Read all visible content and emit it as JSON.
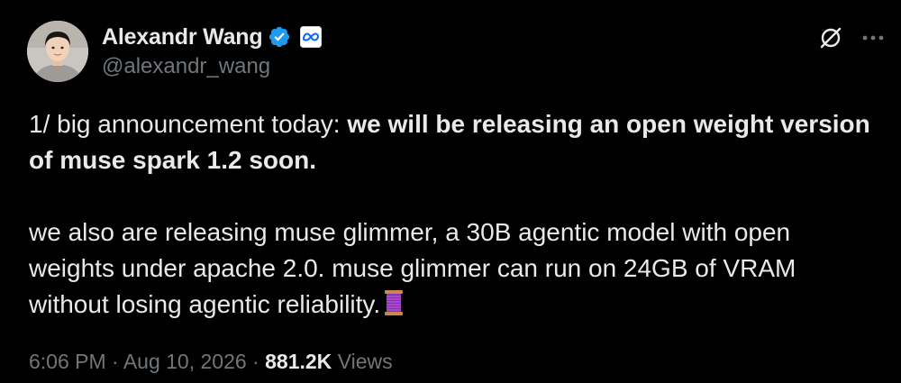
{
  "author": {
    "display_name": "Alexandr Wang",
    "handle": "@alexandr_wang",
    "verified": true,
    "avatar_icon": "avatar-photo",
    "affiliate_icon": "meta-logo-icon"
  },
  "header_actions": {
    "grok_icon": "grok-icon",
    "more_icon": "more-icon"
  },
  "tweet": {
    "para1_normal": "1/ big announcement today: ",
    "para1_bold": "we will be releasing an open weight version of muse spark 1.2 soon.",
    "para2": "we also are releasing muse glimmer, a 30B agentic model with open weights under apache 2.0. muse glimmer can run on 24GB of VRAM without losing agentic reliability.",
    "emoji": "spool-of-thread-emoji"
  },
  "meta": {
    "time": "6:06 PM",
    "separator": " · ",
    "date": "Aug 10, 2026",
    "views_count": "881.2K",
    "views_label": "Views"
  },
  "colors": {
    "background": "#000000",
    "text": "#e7e9ea",
    "secondary": "#71767b",
    "verified_blue": "#1d9bf0"
  }
}
